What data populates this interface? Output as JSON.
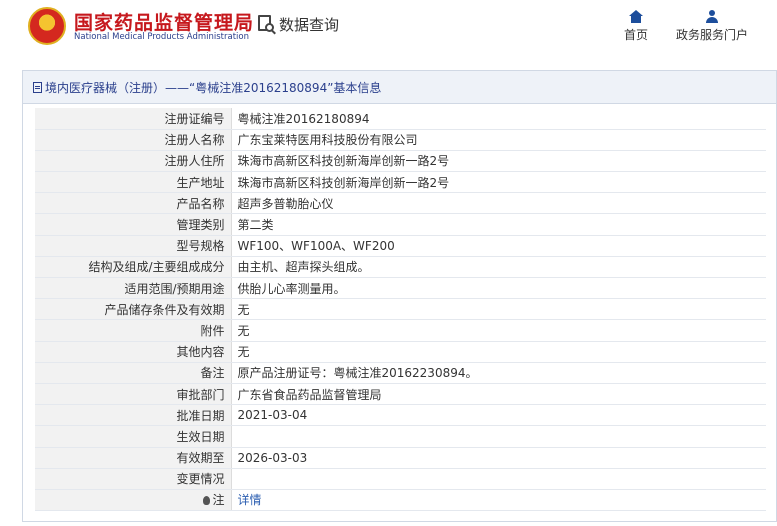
{
  "header": {
    "brand_cn": "国家药品监督管理局",
    "brand_en": "National Medical Products Administration",
    "search_label": "数据查询",
    "nav_home": "首页",
    "nav_service": "政务服务门户",
    "accent_color": "#c6181d",
    "nav_icon_color": "#1d4e9c"
  },
  "panel": {
    "title": "境内医疗器械（注册）——“粤械注准20162180894”基本信息"
  },
  "rows": [
    {
      "label": "注册证编号",
      "value": "粤械注准20162180894"
    },
    {
      "label": "注册人名称",
      "value": "广东宝莱特医用科技股份有限公司"
    },
    {
      "label": "注册人住所",
      "value": "珠海市高新区科技创新海岸创新一路2号"
    },
    {
      "label": "生产地址",
      "value": "珠海市高新区科技创新海岸创新一路2号"
    },
    {
      "label": "产品名称",
      "value": "超声多普勒胎心仪"
    },
    {
      "label": "管理类别",
      "value": "第二类"
    },
    {
      "label": "型号规格",
      "value": "WF100、WF100A、WF200"
    },
    {
      "label": "结构及组成/主要组成成分",
      "value": "由主机、超声探头组成。"
    },
    {
      "label": "适用范围/预期用途",
      "value": "供胎儿心率测量用。"
    },
    {
      "label": "产品储存条件及有效期",
      "value": "无"
    },
    {
      "label": "附件",
      "value": "无"
    },
    {
      "label": "其他内容",
      "value": "无"
    },
    {
      "label": "备注",
      "value": "原产品注册证号：粤械注准20162230894。"
    },
    {
      "label": "审批部门",
      "value": "广东省食品药品监督管理局"
    },
    {
      "label": "批准日期",
      "value": "2021-03-04"
    },
    {
      "label": "生效日期",
      "value": ""
    },
    {
      "label": "有效期至",
      "value": "2026-03-03"
    },
    {
      "label": "变更情况",
      "value": ""
    },
    {
      "label": "注",
      "value": "详情"
    }
  ]
}
